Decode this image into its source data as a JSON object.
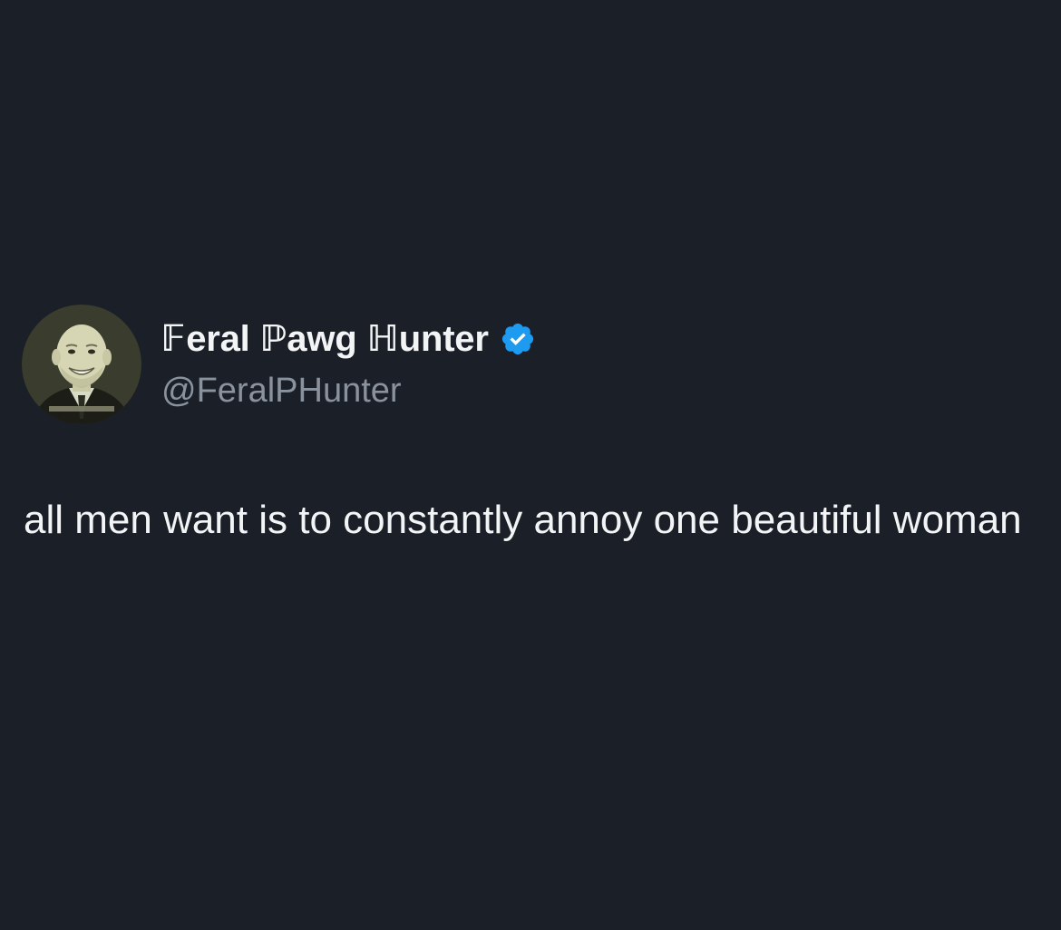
{
  "theme": {
    "background": "#1a1f28",
    "text_primary": "#f2f4f5",
    "text_secondary": "#8a939d",
    "verified_blue": "#1d9bf0"
  },
  "tweet": {
    "display_name": "𝔽eral ℙawg ℍunter",
    "handle": "@FeralPHunter",
    "text": "all men want is to constantly annoy one beautiful woman",
    "avatar_icon": "user-avatar-photo",
    "verified_icon": "verified-badge-icon"
  }
}
